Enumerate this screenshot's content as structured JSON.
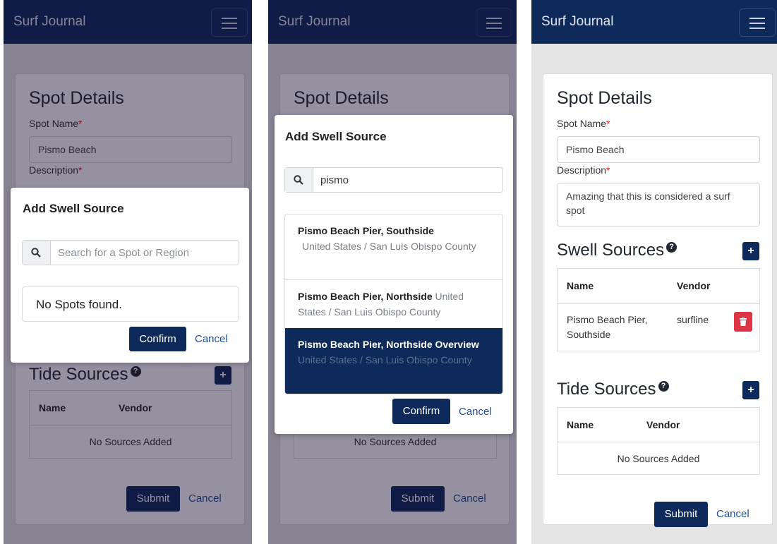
{
  "app": {
    "title": "Surf Journal"
  },
  "form": {
    "heading": "Spot Details",
    "spot_name_label": "Spot Name",
    "spot_name_value": "Pismo Beach",
    "description_label": "Description",
    "description_value": "Amazing that this is considered a surf spot",
    "required_mark": "*"
  },
  "swell_sources": {
    "title": "Swell Sources",
    "columns": [
      "Name",
      "Vendor"
    ],
    "rows": [
      {
        "name": "Pismo Beach Pier, Southside",
        "vendor": "surfline"
      }
    ]
  },
  "tide_sources": {
    "title": "Tide Sources",
    "columns": [
      "Name",
      "Vendor"
    ],
    "empty_text": "No Sources Added"
  },
  "actions": {
    "submit": "Submit",
    "cancel": "Cancel"
  },
  "modal_empty": {
    "title": "Add Swell Source",
    "search_placeholder": "Search for a Spot or Region",
    "no_results": "No Spots found.",
    "confirm": "Confirm",
    "cancel": "Cancel"
  },
  "modal_results": {
    "title": "Add Swell Source",
    "search_value": "pismo",
    "results": [
      {
        "name": "Pismo Beach Pier, Southside",
        "location": "United States / San Luis Obispo County"
      },
      {
        "name": "Pismo Beach Pier, Northside",
        "location": "United States / San Luis Obispo County"
      },
      {
        "name": "Pismo Beach Pier, Northside Overview",
        "location": "United States / San Luis Obispo County"
      }
    ],
    "selected_index": 2,
    "confirm": "Confirm",
    "cancel": "Cancel"
  },
  "icons": {
    "menu": "hamburger-menu-icon",
    "search": "search-icon",
    "help": "question-circle-icon",
    "add": "plus-icon",
    "delete": "trash-icon"
  },
  "colors": {
    "brand": "#0e2a5a",
    "danger": "#dc3545",
    "required": "#d9232d",
    "link": "#1f4f91"
  }
}
